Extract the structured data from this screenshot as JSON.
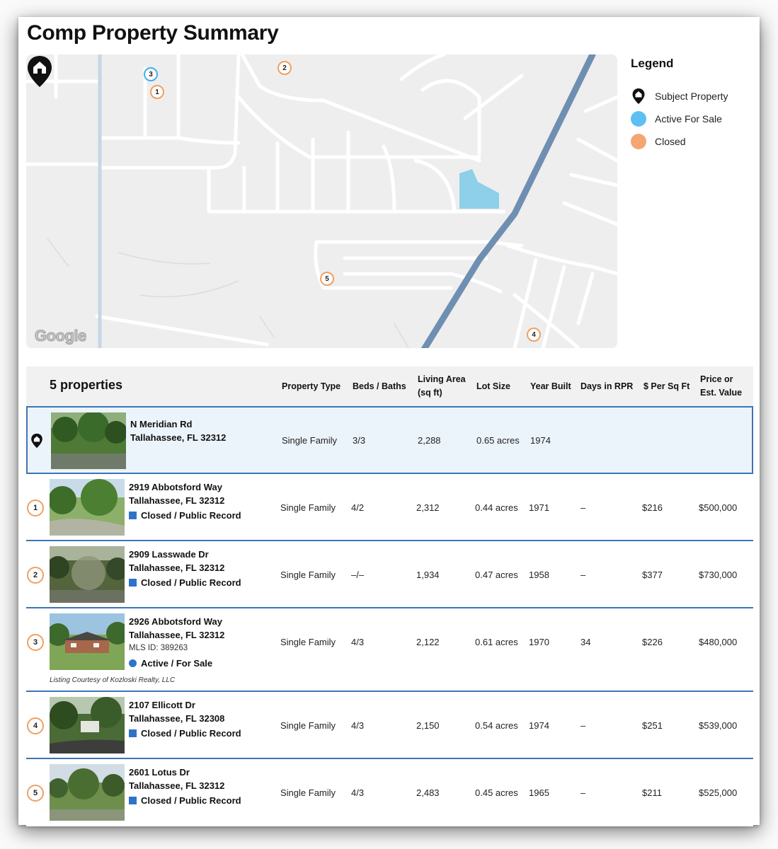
{
  "page_title": "Comp Property Summary",
  "map": {
    "provider_label": "Google",
    "pins": [
      {
        "label": "1",
        "status": "closed"
      },
      {
        "label": "2",
        "status": "closed"
      },
      {
        "label": "3",
        "status": "active"
      },
      {
        "label": "4",
        "status": "closed"
      },
      {
        "label": "5",
        "status": "closed"
      }
    ]
  },
  "legend": {
    "title": "Legend",
    "items": [
      {
        "label": "Subject Property",
        "icon": "house-pin-icon"
      },
      {
        "label": "Active For Sale",
        "color": "#5ec0f2"
      },
      {
        "label": "Closed",
        "color": "#f3a672"
      }
    ]
  },
  "table": {
    "count_label": "5 properties",
    "headers": {
      "property_type": "Property Type",
      "beds_baths": "Beds / Baths",
      "living_area_1": "Living Area",
      "living_area_2": "(sq ft)",
      "lot_size": "Lot Size",
      "year_built": "Year Built",
      "days_in_rpr": "Days in RPR",
      "per_sq_ft": "$ Per Sq Ft",
      "price_1": "Price or",
      "price_2": "Est. Value"
    },
    "subject": {
      "street": "N Meridian Rd",
      "city": "Tallahassee, FL 32312",
      "property_type": "Single Family",
      "beds_baths": "3/3",
      "living_area": "2,288",
      "lot_size": "0.65 acres",
      "year_built": "1974"
    },
    "rows": [
      {
        "num": "1",
        "street": "2919 Abbotsford Way",
        "city": "Tallahassee, FL 32312",
        "status": "Closed / Public Record",
        "property_type": "Single Family",
        "beds_baths": "4/2",
        "living_area": "2,312",
        "lot_size": "0.44 acres",
        "year_built": "1971",
        "days": "–",
        "per_sq_ft": "$216",
        "price": "$500,000"
      },
      {
        "num": "2",
        "street": "2909 Lasswade Dr",
        "city": "Tallahassee, FL 32312",
        "status": "Closed / Public Record",
        "property_type": "Single Family",
        "beds_baths": "–/–",
        "living_area": "1,934",
        "lot_size": "0.47 acres",
        "year_built": "1958",
        "days": "–",
        "per_sq_ft": "$377",
        "price": "$730,000"
      },
      {
        "num": "3",
        "street": "2926 Abbotsford Way",
        "city": "Tallahassee, FL 32312",
        "mls": "MLS ID: 389263",
        "status": "Active / For Sale",
        "courtesy": "Listing Courtesy of Kozloski Realty, LLC",
        "property_type": "Single Family",
        "beds_baths": "4/3",
        "living_area": "2,122",
        "lot_size": "0.61 acres",
        "year_built": "1970",
        "days": "34",
        "per_sq_ft": "$226",
        "price": "$480,000"
      },
      {
        "num": "4",
        "street": "2107 Ellicott Dr",
        "city": "Tallahassee, FL 32308",
        "status": "Closed / Public Record",
        "property_type": "Single Family",
        "beds_baths": "4/3",
        "living_area": "2,150",
        "lot_size": "0.54 acres",
        "year_built": "1974",
        "days": "–",
        "per_sq_ft": "$251",
        "price": "$539,000"
      },
      {
        "num": "5",
        "street": "2601 Lotus Dr",
        "city": "Tallahassee, FL 32312",
        "status": "Closed / Public Record",
        "property_type": "Single Family",
        "beds_baths": "4/3",
        "living_area": "2,483",
        "lot_size": "0.45 acres",
        "year_built": "1965",
        "days": "–",
        "per_sq_ft": "$211",
        "price": "$525,000"
      }
    ]
  },
  "colors": {
    "active": "#3fb0ec",
    "closed": "#f0a060",
    "row_divider": "#3d74b8",
    "status_blue": "#2f73c8"
  }
}
